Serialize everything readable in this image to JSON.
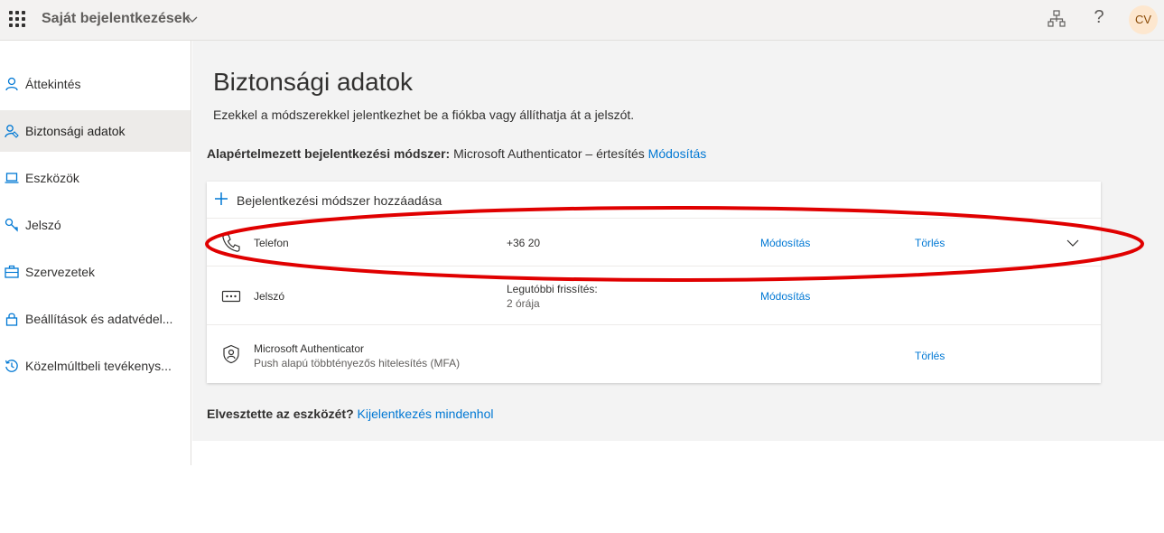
{
  "header": {
    "app_title": "Saját bejelentkezések",
    "avatar_initials": "CV",
    "help_glyph": "?"
  },
  "sidebar": {
    "items": [
      {
        "label": "Áttekintés",
        "icon": "person-icon"
      },
      {
        "label": "Biztonsági adatok",
        "icon": "security-info-icon",
        "active": true
      },
      {
        "label": "Eszközök",
        "icon": "laptop-icon"
      },
      {
        "label": "Jelszó",
        "icon": "key-icon"
      },
      {
        "label": "Szervezetek",
        "icon": "briefcase-icon"
      },
      {
        "label": "Beállítások és adatvédel...",
        "icon": "lock-icon"
      },
      {
        "label": "Közelmúltbeli tevékenys...",
        "icon": "history-icon"
      }
    ]
  },
  "main": {
    "title": "Biztonsági adatok",
    "subtitle": "Ezekkel a módszerekkel jelentkezhet be a fiókba vagy állíthatja át a jelszót.",
    "default_method_label": "Alapértelmezett bejelentkezési módszer:",
    "default_method_value": "Microsoft Authenticator – értesítés",
    "default_method_change": "Módosítás",
    "add_method_label": "Bejelentkezési módszer hozzáadása",
    "methods": [
      {
        "name": "Telefon",
        "detail": "+36 20",
        "change": "Módosítás",
        "delete": "Törlés",
        "icon": "phone-icon"
      },
      {
        "name": "Jelszó",
        "detail": "Legutóbbi frissítés:",
        "detail2": "2 órája",
        "change": "Módosítás",
        "icon": "password-icon"
      },
      {
        "name": "Microsoft Authenticator",
        "desc": "Push alapú többtényezős hitelesítés (MFA)",
        "delete": "Törlés",
        "icon": "authenticator-icon"
      }
    ],
    "lost_device_label": "Elvesztette az eszközét?",
    "lost_device_link": "Kijelentkezés mindenhol"
  },
  "colors": {
    "accent": "#0078d4",
    "annotation": "#e00000"
  }
}
